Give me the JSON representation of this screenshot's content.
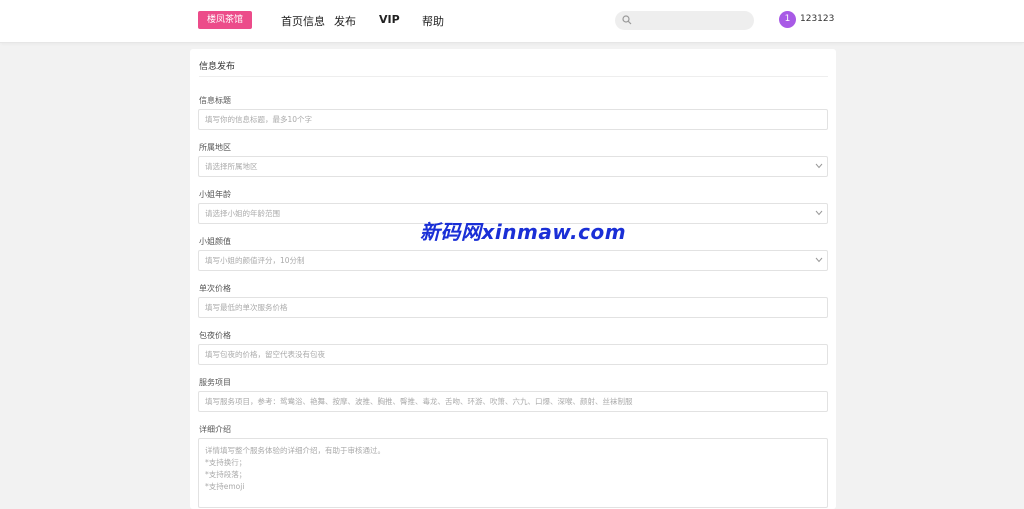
{
  "header": {
    "logo": "楼凤茶馆",
    "nav": [
      "首页信息",
      "发布",
      "VIP",
      "帮助"
    ],
    "search": {
      "value": "",
      "placeholder": ""
    },
    "user": {
      "avatar_text": "1",
      "name": "123123"
    }
  },
  "form": {
    "title": "信息发布",
    "fields": [
      {
        "label": "信息标题",
        "placeholder": "填写你的信息标题，最多10个字"
      },
      {
        "label": "所属地区",
        "placeholder": "请选择所属地区"
      },
      {
        "label": "小姐年龄",
        "placeholder": "请选择小姐的年龄范围"
      },
      {
        "label": "小姐颜值",
        "placeholder": "填写小姐的颜值评分，10分制"
      },
      {
        "label": "单次价格",
        "placeholder": "填写最低的单次服务价格"
      },
      {
        "label": "包夜价格",
        "placeholder": "填写包夜的价格，留空代表没有包夜"
      },
      {
        "label": "服务项目",
        "placeholder": "填写服务项目，参考：鸳鸯浴、艳舞、按摩、波推、胸推、臀推、毒龙、舌吻、环游、吹箫、六九、口爆、深喉、颜射、丝袜制服"
      },
      {
        "label": "详细介绍",
        "placeholder_lines": [
          "详情填写整个服务体验的详细介绍，有助于审核通过。",
          "*支持换行；",
          "*支持段落；",
          "*支持emoji"
        ]
      }
    ]
  },
  "watermark": "新码网xinmaw.com"
}
